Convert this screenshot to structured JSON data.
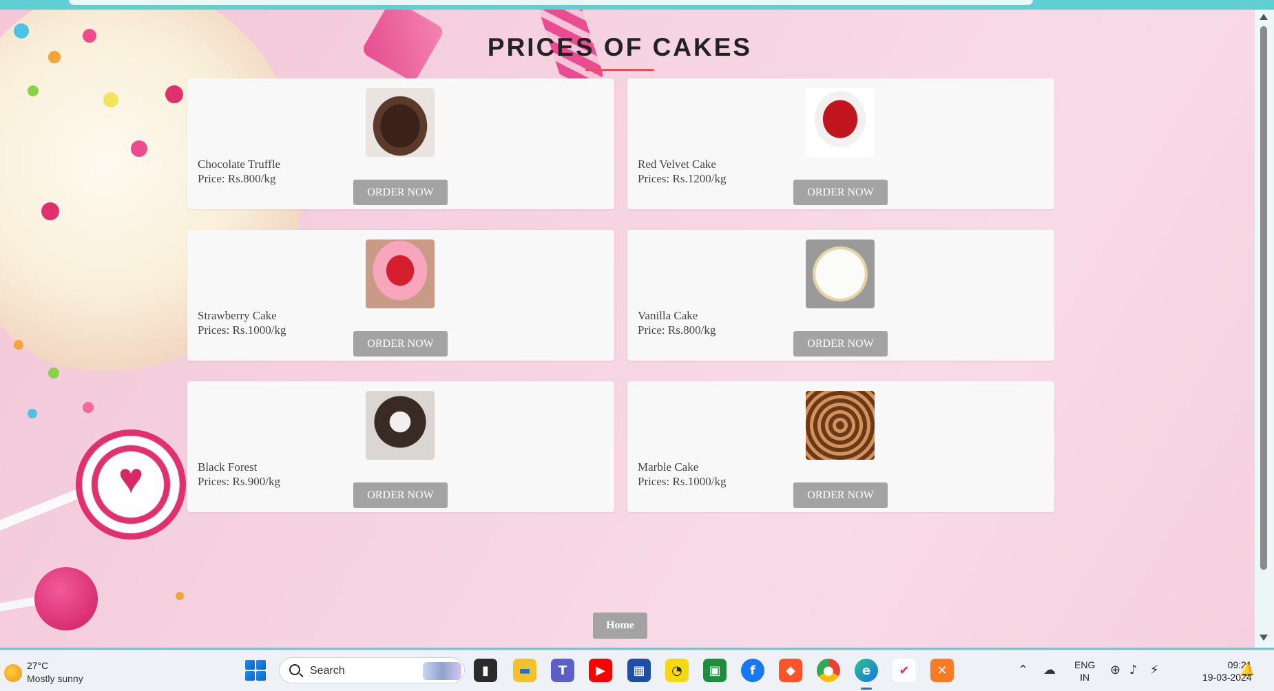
{
  "page": {
    "title": "PRICES OF CAKES",
    "home_label": "Home"
  },
  "cakes": [
    {
      "name": "Chocolate Truffle",
      "price": "Price: Rs.800/kg",
      "button": "ORDER NOW",
      "image": "chocolate-truffle-cake-image"
    },
    {
      "name": "Red Velvet Cake",
      "price": "Prices: Rs.1200/kg",
      "button": "ORDER NOW",
      "image": "red-velvet-cake-image"
    },
    {
      "name": "Strawberry Cake",
      "price": "Prices: Rs.1000/kg",
      "button": "ORDER NOW",
      "image": "strawberry-cake-image"
    },
    {
      "name": "Vanilla Cake",
      "price": "Price: Rs.800/kg",
      "button": "ORDER NOW",
      "image": "vanilla-cake-image"
    },
    {
      "name": "Black Forest",
      "price": "Prices: Rs.900/kg",
      "button": "ORDER NOW",
      "image": "black-forest-cake-image"
    },
    {
      "name": "Marble Cake",
      "price": "Prices: Rs.1000/kg",
      "button": "ORDER NOW",
      "image": "marble-cake-image"
    }
  ],
  "taskbar": {
    "weather_temp": "27°C",
    "weather_desc": "Mostly sunny",
    "search_label": "Search",
    "lang_line1": "ENG",
    "lang_line2": "IN",
    "time": "09:21",
    "date": "19-03-2024",
    "apps": [
      "task-view-icon",
      "file-explorer-icon",
      "teams-icon",
      "youtube-icon",
      "microsoft-store-icon",
      "app-icon",
      "google-classroom-icon",
      "facebook-icon",
      "brave-icon",
      "chrome-icon",
      "edge-icon",
      "app-icon",
      "xampp-icon"
    ]
  },
  "colors": {
    "accent_underline": "#e8505b",
    "button_gray": "#a3a3a3",
    "card_bg": "#f8f8f8",
    "frame_teal": "#5fcfd3"
  }
}
